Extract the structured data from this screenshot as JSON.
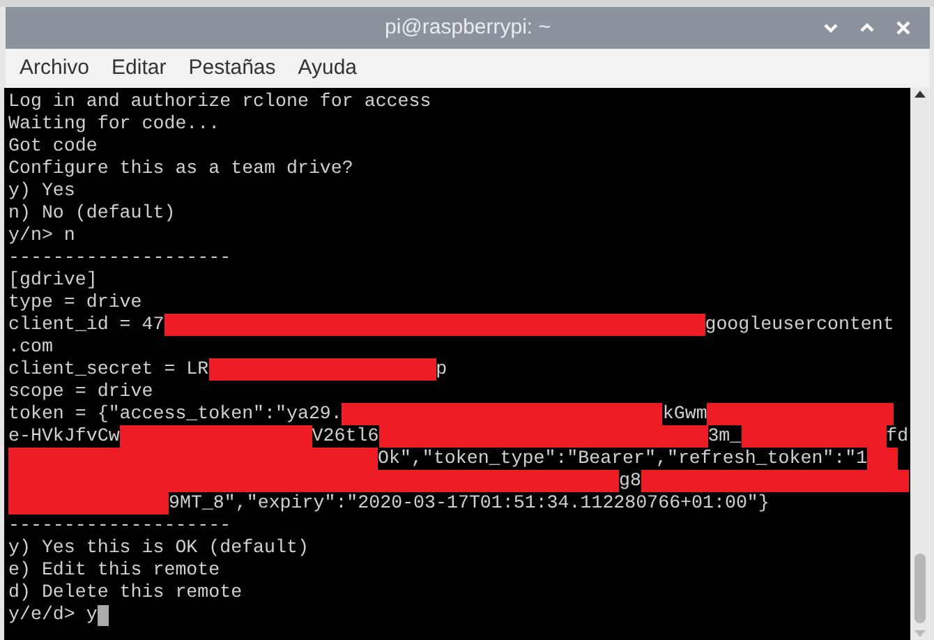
{
  "window": {
    "title": "pi@raspberrypi: ~"
  },
  "menu": [
    "Archivo",
    "Editar",
    "Pestañas",
    "Ayuda"
  ],
  "terminal": {
    "lines": [
      {
        "segments": [
          {
            "kind": "text",
            "text": "Log in and authorize rclone for access"
          }
        ]
      },
      {
        "segments": [
          {
            "kind": "text",
            "text": "Waiting for code..."
          }
        ]
      },
      {
        "segments": [
          {
            "kind": "text",
            "text": "Got code"
          }
        ]
      },
      {
        "segments": [
          {
            "kind": "text",
            "text": "Configure this as a team drive?"
          }
        ]
      },
      {
        "segments": [
          {
            "kind": "text",
            "text": "y) Yes"
          }
        ]
      },
      {
        "segments": [
          {
            "kind": "text",
            "text": "n) No (default)"
          }
        ]
      },
      {
        "segments": [
          {
            "kind": "text",
            "text": "y/n> n"
          }
        ]
      },
      {
        "segments": [
          {
            "kind": "text",
            "text": "--------------------"
          }
        ]
      },
      {
        "segments": [
          {
            "kind": "text",
            "text": "[gdrive]"
          }
        ]
      },
      {
        "segments": [
          {
            "kind": "text",
            "text": "type = drive"
          }
        ]
      },
      {
        "segments": [
          {
            "kind": "text",
            "text": "client_id = 47"
          },
          {
            "kind": "redacted"
          },
          {
            "kind": "text",
            "text": "googleusercontent"
          }
        ]
      },
      {
        "segments": [
          {
            "kind": "text",
            "text": ".com"
          }
        ]
      },
      {
        "segments": [
          {
            "kind": "text",
            "text": "client_secret = LR"
          },
          {
            "kind": "redacted"
          },
          {
            "kind": "text",
            "text": "p"
          }
        ]
      },
      {
        "segments": [
          {
            "kind": "text",
            "text": "scope = drive"
          }
        ]
      },
      {
        "segments": [
          {
            "kind": "text",
            "text": "token = {\"access_token\":\"ya29."
          },
          {
            "kind": "redacted"
          },
          {
            "kind": "text",
            "text": "kGwm"
          },
          {
            "kind": "redacted"
          }
        ]
      },
      {
        "segments": [
          {
            "kind": "text",
            "text": "e-HVkJfvCw"
          },
          {
            "kind": "redacted"
          },
          {
            "kind": "text",
            "text": "V26tl6"
          },
          {
            "kind": "redacted"
          },
          {
            "kind": "text",
            "text": "3m_"
          },
          {
            "kind": "redacted"
          },
          {
            "kind": "text",
            "text": "fd"
          }
        ]
      },
      {
        "segments": [
          {
            "kind": "redacted"
          },
          {
            "kind": "text",
            "text": "Ok\",\"token_type\":\"Bearer\",\"refresh_token\":\"1"
          },
          {
            "kind": "redacted"
          }
        ]
      },
      {
        "segments": [
          {
            "kind": "redacted"
          },
          {
            "kind": "text",
            "text": "g8"
          },
          {
            "kind": "redacted"
          }
        ]
      },
      {
        "segments": [
          {
            "kind": "redacted"
          },
          {
            "kind": "text",
            "text": "9MT_8\",\"expiry\":\"2020-03-17T01:51:34.112280766+01:00\"}"
          }
        ]
      },
      {
        "segments": [
          {
            "kind": "text",
            "text": "--------------------"
          }
        ]
      },
      {
        "segments": [
          {
            "kind": "text",
            "text": "y) Yes this is OK (default)"
          }
        ]
      },
      {
        "segments": [
          {
            "kind": "text",
            "text": "e) Edit this remote"
          }
        ]
      },
      {
        "segments": [
          {
            "kind": "text",
            "text": "d) Delete this remote"
          }
        ]
      },
      {
        "segments": [
          {
            "kind": "text",
            "text": "y/e/d> y"
          }
        ],
        "cursor": true
      }
    ]
  }
}
